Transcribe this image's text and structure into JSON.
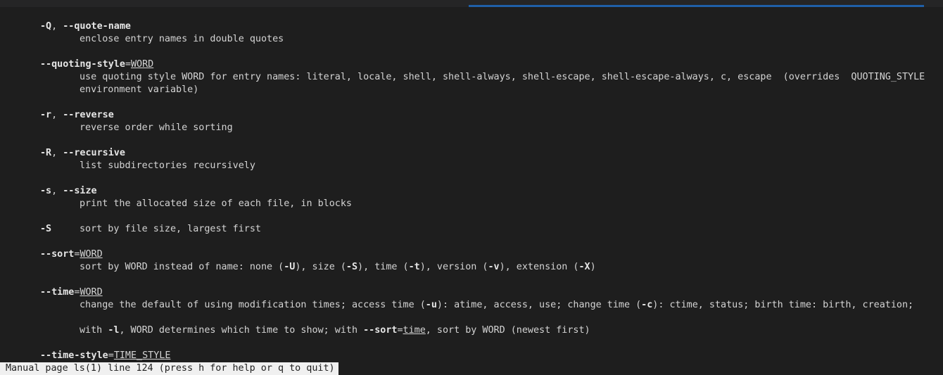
{
  "entries": {
    "quote_name": {
      "short": "-Q",
      "sep": ", ",
      "long": "--quote-name",
      "desc": "enclose entry names in double quotes"
    },
    "quoting_style": {
      "long": "--quoting-style",
      "eq": "=",
      "arg": "WORD",
      "desc1": "use quoting style WORD for entry names: literal, locale, shell, shell-always, shell-escape, shell-escape-always, c, escape  (overrides  QUOTING_STYLE",
      "desc2": "environment variable)"
    },
    "reverse": {
      "short": "-r",
      "sep": ", ",
      "long": "--reverse",
      "desc": "reverse order while sorting"
    },
    "recursive": {
      "short": "-R",
      "sep": ", ",
      "long": "--recursive",
      "desc": "list subdirectories recursively"
    },
    "size": {
      "short": "-s",
      "sep": ", ",
      "long": "--size",
      "desc": "print the allocated size of each file, in blocks"
    },
    "sort_size": {
      "short": "-S",
      "desc": "sort by file size, largest first"
    },
    "sort": {
      "long": "--sort",
      "eq": "=",
      "arg": "WORD",
      "d1": "sort by WORD instead of name: none (",
      "f1": "-U",
      "d2": "), size (",
      "f2": "-S",
      "d3": "), time (",
      "f3": "-t",
      "d4": "), version (",
      "f4": "-v",
      "d5": "), extension (",
      "f5": "-X",
      "d6": ")"
    },
    "time": {
      "long": "--time",
      "eq": "=",
      "arg": "WORD",
      "a1": "change the default of using modification times; access time (",
      "af1": "-u",
      "a2": "): atime, access, use; change time (",
      "af2": "-c",
      "a3": "): ctime, status; birth time: birth, creation;",
      "b1": "with ",
      "bf1": "-l",
      "b2": ", WORD determines which time to show; with ",
      "bf2": "--sort",
      "b3": "=",
      "bu": "time",
      "b4": ", sort by WORD (newest first)"
    },
    "time_style": {
      "long": "--time-style",
      "eq": "=",
      "arg": "TIME_STYLE"
    }
  },
  "status": {
    "text": "Manual page ls(1) line 124 (press h for help or q to quit)"
  }
}
